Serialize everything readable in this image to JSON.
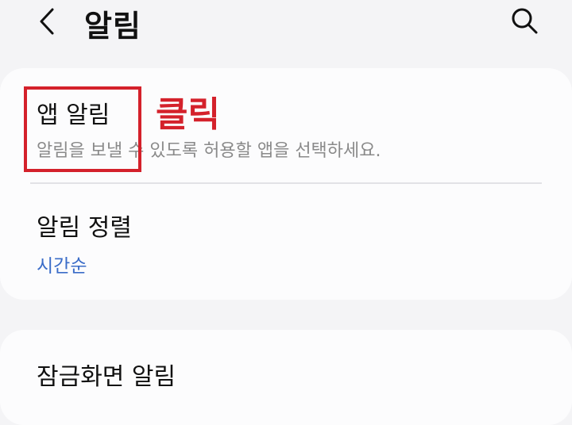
{
  "header": {
    "title": "알림",
    "back_icon": "chevron-left-icon",
    "search_icon": "search-icon"
  },
  "app_notifications": {
    "title": "앱 알림",
    "subtitle": "알림을 보낼 수 있도록 허용할 앱을 선택하세요."
  },
  "notification_sort": {
    "title": "알림 정렬",
    "value": "시간순"
  },
  "lockscreen": {
    "title": "잠금화면 알림"
  },
  "annotation": {
    "label": "클릭",
    "color": "#d4212b"
  },
  "colors": {
    "accent_blue": "#3a6cc8",
    "background": "#f4f4f6",
    "card": "#fcfcfd"
  }
}
